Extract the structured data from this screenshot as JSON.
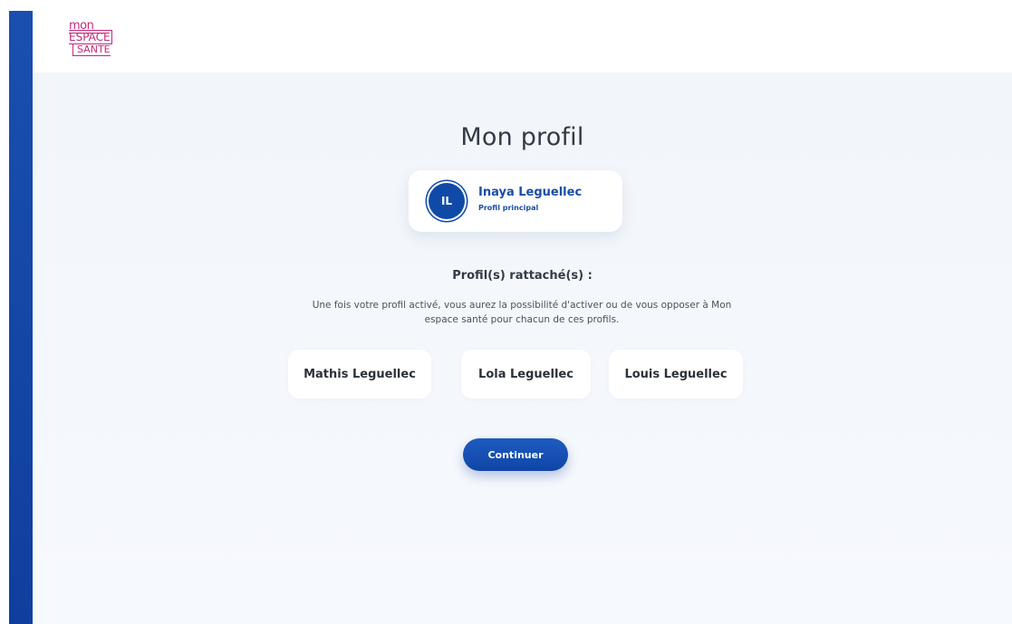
{
  "brand": {
    "logo_line1": "mon",
    "logo_line2": "ESPACE",
    "logo_line3": "SANTE",
    "accent_color": "#c02a7a",
    "primary_color": "#0f4aa8"
  },
  "page": {
    "title": "Mon profil"
  },
  "main_profile": {
    "initials": "IL",
    "name": "Inaya Leguellec",
    "role": "Profil principal"
  },
  "attached": {
    "heading": "Profil(s) rattaché(s) :",
    "description": "Une fois votre profil activé, vous aurez la possibilité d'activer ou de vous opposer à Mon espace santé pour chacun de ces profils.",
    "profiles": [
      {
        "name": "Mathis Leguellec"
      },
      {
        "name": "Lola Leguellec"
      },
      {
        "name": "Louis Leguellec"
      }
    ]
  },
  "actions": {
    "continue_label": "Continuer"
  }
}
